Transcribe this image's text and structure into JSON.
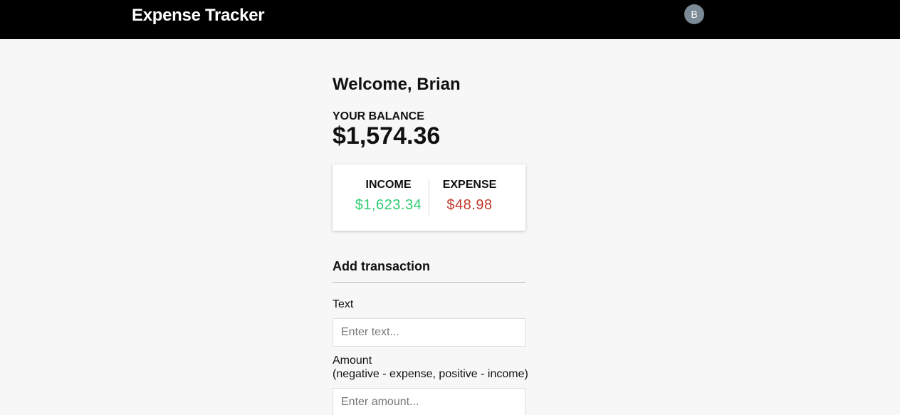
{
  "header": {
    "app_title": "Expense Tracker",
    "avatar_initial": "B"
  },
  "welcome": "Welcome, Brian",
  "balance": {
    "label": "YOUR BALANCE",
    "value": "$1,574.36"
  },
  "summary": {
    "income_label": "INCOME",
    "income_value": "$1,623.34",
    "expense_label": "EXPENSE",
    "expense_value": "$48.98"
  },
  "add_transaction": {
    "title": "Add transaction",
    "text_label": "Text",
    "text_placeholder": "Enter text...",
    "amount_label": "Amount",
    "amount_hint": "(negative - expense, positive - income)",
    "amount_placeholder": "Enter amount..."
  },
  "colors": {
    "header_bg": "#000000",
    "income": "#2ecc71",
    "expense": "#c0392b",
    "avatar_bg": "#7a8a96"
  }
}
